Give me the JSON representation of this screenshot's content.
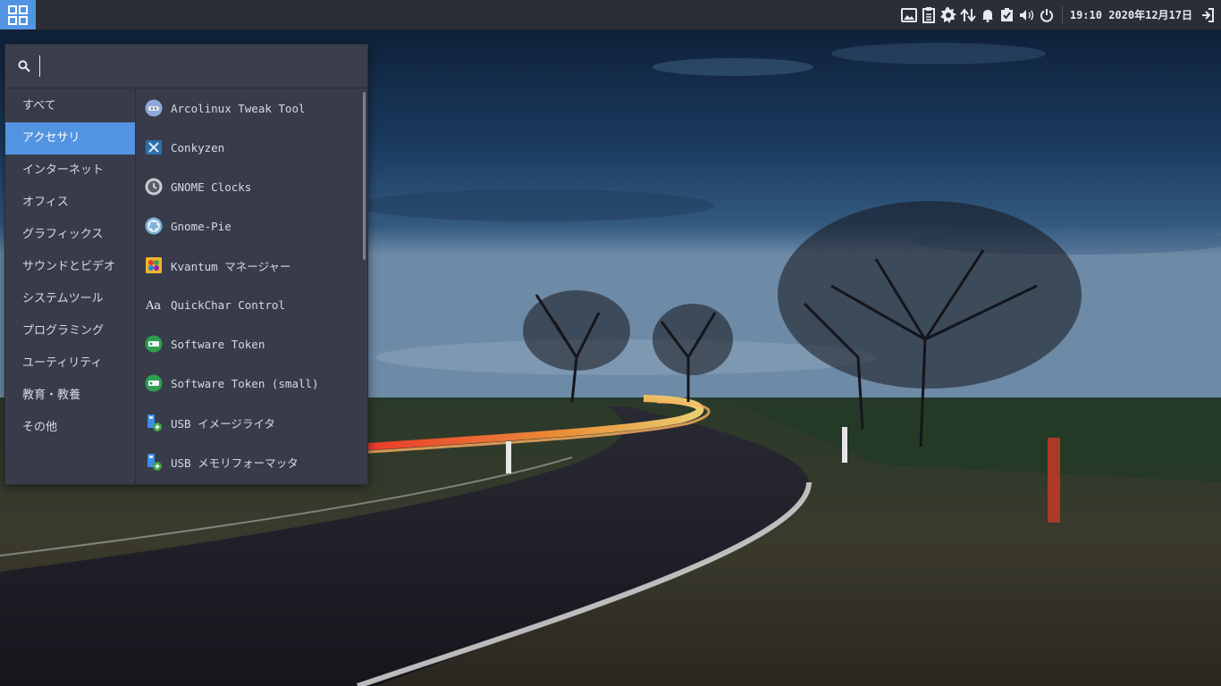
{
  "panel": {
    "menu_button_icon": "grid-icon",
    "tray_icons": [
      "image-viewer-icon",
      "clipboard-icon",
      "settings-gear-icon",
      "network-arrows-icon",
      "notification-bell-icon",
      "checkbox-task-icon",
      "volume-icon",
      "power-icon"
    ],
    "clock": "19:10  2020年12月17日",
    "logout_icon": "logout-icon",
    "accent_color": "#5294e2"
  },
  "app_menu": {
    "search": {
      "value": "",
      "icon": "search-icon"
    },
    "categories": [
      {
        "label": "すべて"
      },
      {
        "label": "アクセサリ"
      },
      {
        "label": "インターネット"
      },
      {
        "label": "オフィス"
      },
      {
        "label": "グラフィックス"
      },
      {
        "label": "サウンドとビデオ"
      },
      {
        "label": "システムツール"
      },
      {
        "label": "プログラミング"
      },
      {
        "label": "ユーティリティ"
      },
      {
        "label": "教育・教養"
      },
      {
        "label": "その他"
      }
    ],
    "selected_category": "アクセサリ",
    "apps": [
      {
        "label": "Arcolinux Tweak Tool",
        "icon": "tweak-tool-icon"
      },
      {
        "label": "Conkyzen",
        "icon": "conkyzen-icon"
      },
      {
        "label": "GNOME Clocks",
        "icon": "clock-icon"
      },
      {
        "label": "Gnome-Pie",
        "icon": "gnome-pie-icon"
      },
      {
        "label": "Kvantum マネージャー",
        "icon": "kvantum-icon"
      },
      {
        "label": "QuickChar Control",
        "icon": "quickchar-icon"
      },
      {
        "label": "Software Token",
        "icon": "software-token-icon"
      },
      {
        "label": "Software Token (small)",
        "icon": "software-token-small-icon"
      },
      {
        "label": "USB イメージライタ",
        "icon": "usb-image-writer-icon"
      },
      {
        "label": "USB メモリフォーマッタ",
        "icon": "usb-formatter-icon"
      }
    ]
  }
}
